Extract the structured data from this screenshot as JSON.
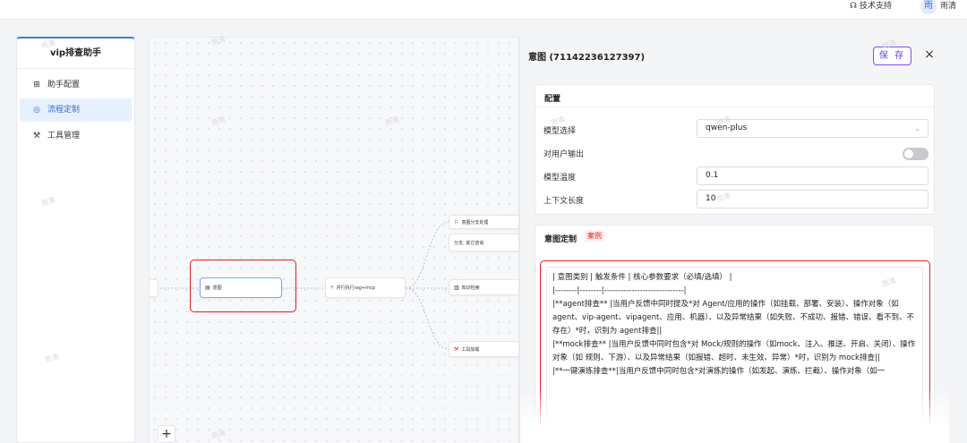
{
  "header": {
    "support_label": "技术支持",
    "avatar_text": "雨",
    "user_name": "雨清"
  },
  "sidebar": {
    "title": "vip排查助手",
    "items": [
      {
        "label": "助手配置",
        "icon": "grid-icon"
      },
      {
        "label": "流程定制",
        "icon": "flow-icon",
        "active": true
      },
      {
        "label": "工具管理",
        "icon": "wrench-icon"
      }
    ]
  },
  "canvas": {
    "nodes": {
      "intent": "意图",
      "parallel": "并行执行rag+mcp",
      "intent_branch": "意图分支处理",
      "branch_other": "分支: 其它咨询",
      "knowledge": "知识检索",
      "tool_loading": "工具加载"
    },
    "zoom_in_label": "+"
  },
  "panel": {
    "title": "意图 (71142236127397)",
    "save_label": "保 存",
    "close_label": "×",
    "config": {
      "title": "配置",
      "model_label": "模型选择",
      "model_value": "qwen-plus",
      "output_label": "对用户输出",
      "output_enabled": false,
      "temperature_label": "模型温度",
      "temperature_value": "0.1",
      "context_label": "上下文长度",
      "context_value": "10"
    },
    "intent_custom": {
      "title": "意图定制",
      "tag": "案例",
      "text": "| 意图类别 | 触发条件 | 核心参数要求（必填/选填） |\n|--------|--------|-----------------------------|\n|**agent排查** |当用户反馈中同时提及*对 Agent/应用的操作（如挂载、部署、安装）、操作对象（如 agent、vip-agent、vipagent、应用、机器）、以及异常结果（如失败、不成功、报错、错误、看不到、不存在）*时，识别为 agent排查||\n|**mock排查** |当用户反馈中同时包含*对 Mock/规则的操作（如mock、注入、推送、开启、关闭）、操作对象（如 规则、下游）、以及异常结果（如报错、超时、未生效、异常）*时，识别为 mock排查||\n|**一键演练排查**|当用户反馈中同时包含*对演练的操作（如发起、演练、拦截）、操作对象（如一"
    }
  },
  "watermark": "雨清",
  "colors": {
    "accent": "#2f6fd6",
    "save_border": "#7c4dff",
    "highlight": "#e0201b"
  }
}
